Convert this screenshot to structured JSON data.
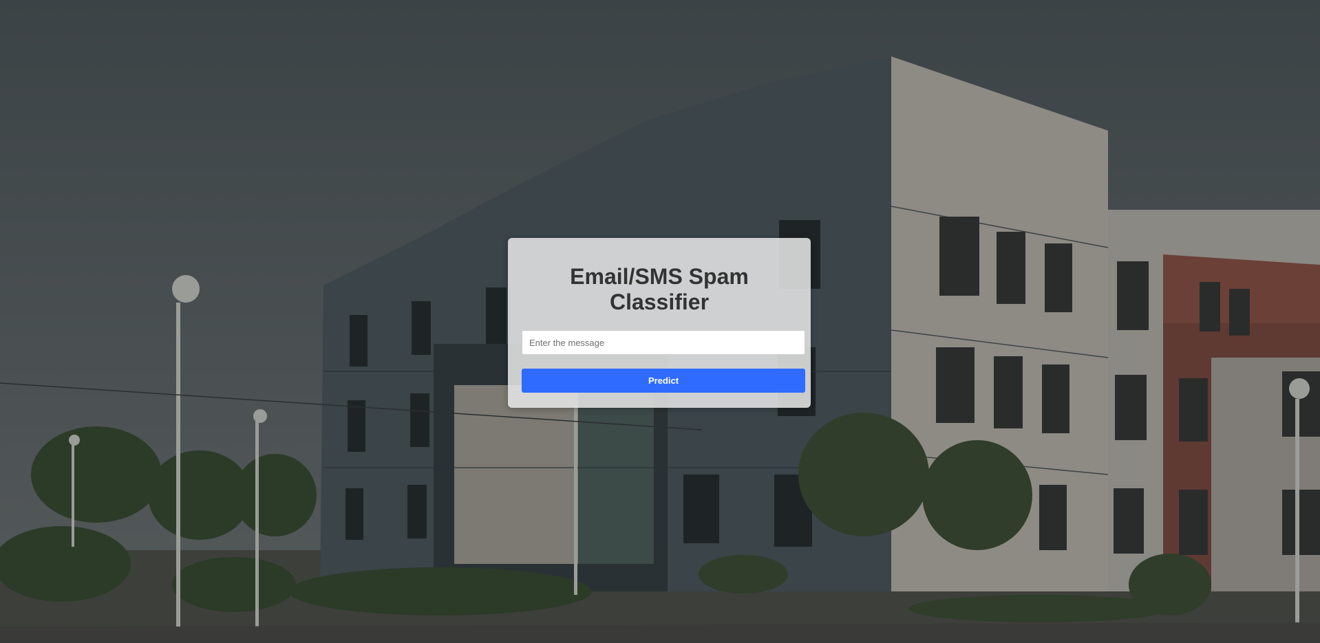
{
  "form": {
    "title": "Email/SMS Spam Classifier",
    "message_placeholder": "Enter the message",
    "message_value": "",
    "predict_label": "Predict"
  },
  "colors": {
    "button": "#2f6bff",
    "title": "#333333",
    "card": "#e8e8e8"
  }
}
